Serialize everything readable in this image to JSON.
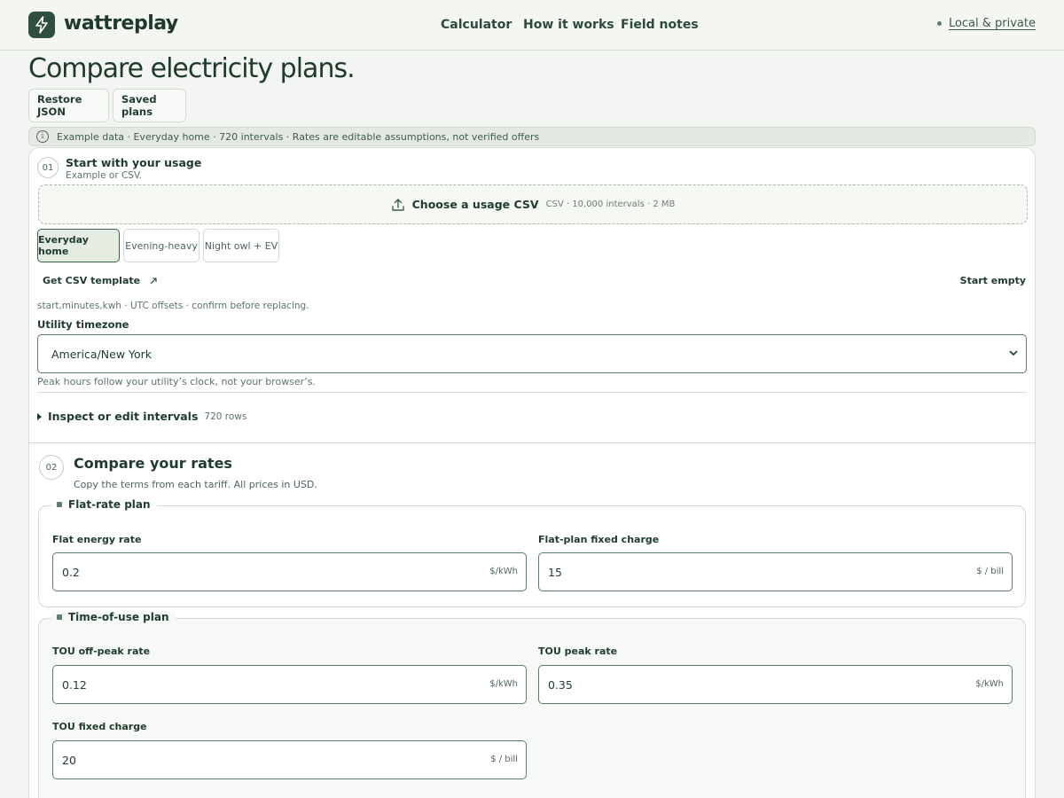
{
  "app": {
    "brand": "wattreplay",
    "brand_suffix": ".",
    "nav": [
      "Calculator",
      "How it works",
      "Field notes"
    ],
    "privacy": "Local & private"
  },
  "page": {
    "title": "Compare electricity plans.",
    "buttons": [
      "Restore JSON",
      "Saved plans"
    ],
    "banner": "Example data · Everyday home · 720 intervals · Rates are editable assumptions, not verified offers"
  },
  "step1": {
    "num": "01",
    "title": "Start with your usage",
    "subtitle": "Example or CSV.",
    "upload_label": "Choose a usage CSV",
    "upload_meta": "CSV · 10,000 intervals · 2 MB",
    "presets": [
      "Everyday home",
      "Evening-heavy",
      "Night owl + EV"
    ],
    "active_preset": "Everyday home",
    "template_link": "Get CSV template",
    "start_empty": "Start empty",
    "csv_hint": "start,minutes,kwh · UTC offsets · confirm before replacing.",
    "tz_label": "Utility timezone",
    "tz_value": "America/New York",
    "tz_help": "Peak hours follow your utility’s clock, not your browser’s.",
    "inspect_label": "Inspect or edit intervals",
    "inspect_count": "720 rows"
  },
  "step2": {
    "num": "02",
    "title": "Compare your rates",
    "subtitle": "Copy the terms from each tariff. All prices in USD.",
    "flat": {
      "legend": "Flat-rate plan",
      "energy_label": "Flat energy rate",
      "energy_value": "0.2",
      "energy_unit": "$/kWh",
      "fixed_label": "Flat-plan fixed charge",
      "fixed_value": "15",
      "fixed_unit": "$ / bill"
    },
    "tou": {
      "legend": "Time-of-use plan",
      "offpeak_label": "TOU off-peak rate",
      "offpeak_value": "0.12",
      "offpeak_unit": "$/kWh",
      "peak_label": "TOU peak rate",
      "peak_value": "0.35",
      "peak_unit": "$/kWh",
      "fixed_label": "TOU fixed charge",
      "fixed_value": "20",
      "fixed_unit": "$ / bill"
    }
  },
  "colors": {
    "accent": "#2f4f3f",
    "background": "#f2f5f1",
    "active_chip": "#e5ede2"
  }
}
